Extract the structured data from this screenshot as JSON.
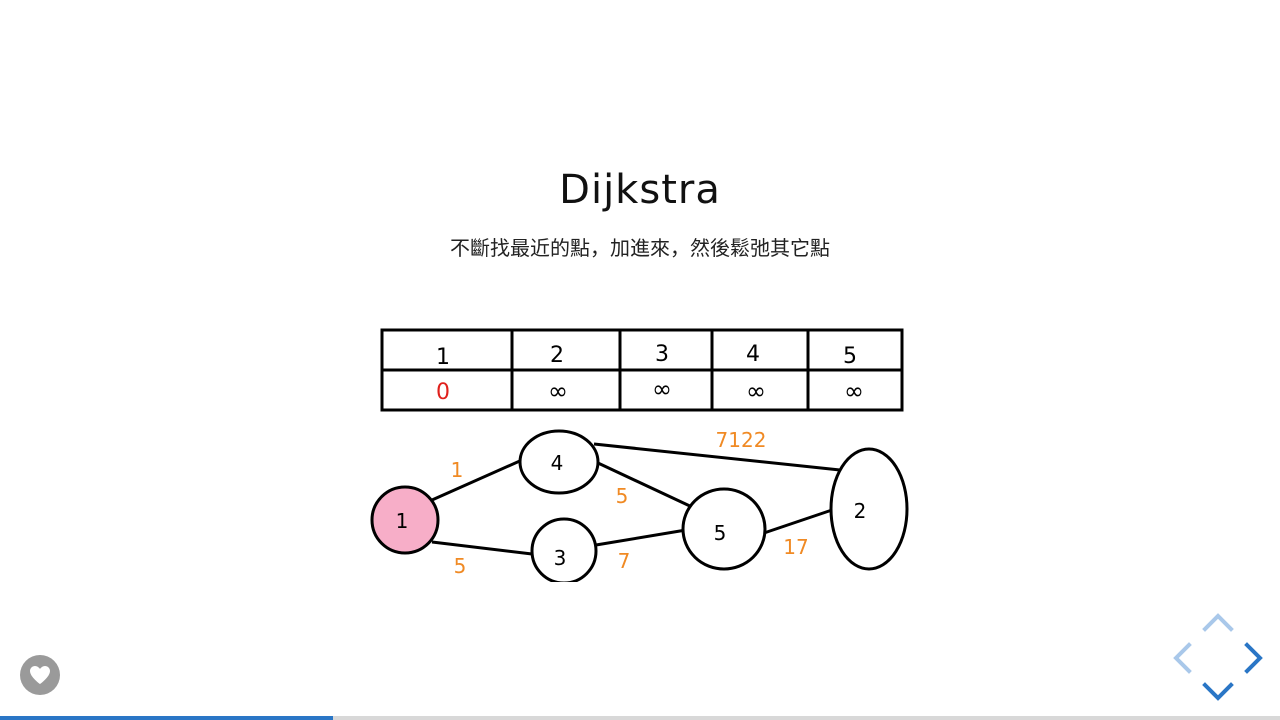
{
  "slide": {
    "title": "Dijkstra",
    "subtitle": "不斷找最近的點，加進來，然後鬆弛其它點"
  },
  "dist_table": {
    "headers": [
      "1",
      "2",
      "3",
      "4",
      "5"
    ],
    "values": [
      "0",
      "∞",
      "∞",
      "∞",
      "∞"
    ],
    "source_value_color": "#e0201c"
  },
  "graph": {
    "nodes": [
      {
        "id": "1",
        "label": "1",
        "highlighted": true
      },
      {
        "id": "4",
        "label": "4",
        "highlighted": false
      },
      {
        "id": "3",
        "label": "3",
        "highlighted": false
      },
      {
        "id": "5",
        "label": "5",
        "highlighted": false
      },
      {
        "id": "2",
        "label": "2",
        "highlighted": false
      }
    ],
    "edges": [
      {
        "from": "1",
        "to": "4",
        "weight": "1"
      },
      {
        "from": "1",
        "to": "3",
        "weight": "5"
      },
      {
        "from": "4",
        "to": "5",
        "weight": "5"
      },
      {
        "from": "3",
        "to": "5",
        "weight": "7"
      },
      {
        "from": "4",
        "to": "2",
        "weight": "7122"
      },
      {
        "from": "5",
        "to": "2",
        "weight": "17"
      }
    ],
    "highlight_color": "#f7aec8",
    "weight_color": "#f08a24"
  },
  "controls": {
    "like_icon": "heart-icon",
    "nav_icons": [
      "chevron-up-icon",
      "chevron-left-icon",
      "chevron-right-icon",
      "chevron-down-icon"
    ],
    "nav_active_color": "#2a76c6",
    "nav_inactive_color": "#a9c8ea"
  },
  "progress": {
    "fraction": 0.26
  }
}
